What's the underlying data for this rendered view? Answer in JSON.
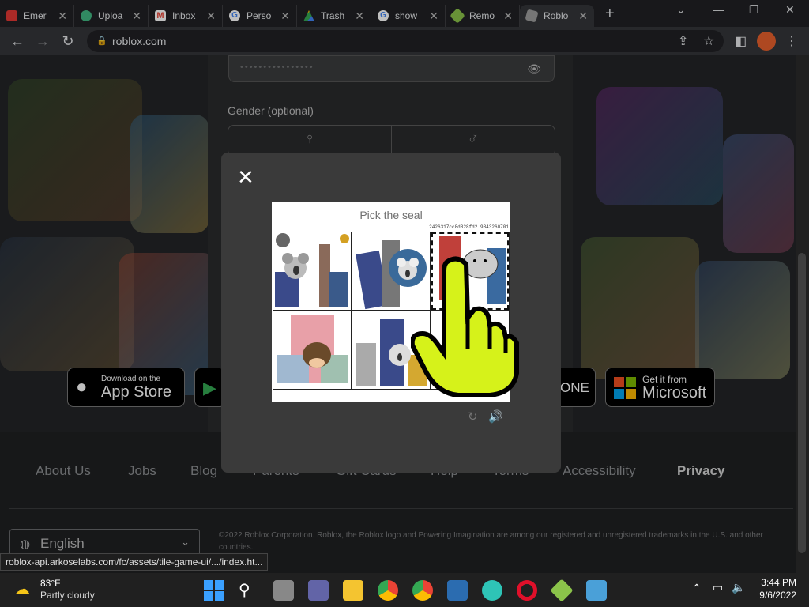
{
  "browser": {
    "tabs": [
      {
        "label": "Emer",
        "color": "#e53935"
      },
      {
        "label": "Uploa",
        "color": "#42b983"
      },
      {
        "label": "Inbox",
        "color": "#ea4335"
      },
      {
        "label": "Perso",
        "color": "#4285f4"
      },
      {
        "label": "Trash",
        "color": "#34a853"
      },
      {
        "label": "show",
        "color": "#4285f4"
      },
      {
        "label": "Remo",
        "color": "#8bc34a"
      },
      {
        "label": "Roblo",
        "color": "#9e9e9e"
      }
    ],
    "url": "roblox.com",
    "new_tab": "+"
  },
  "form": {
    "password_mask": "••••••••••••••••",
    "gender_label": "Gender (optional)"
  },
  "stores": {
    "app_store_top": "Download on the",
    "app_store_bottom": "App Store",
    "xbox_text": "ONE",
    "ms_top": "Get it from",
    "ms_bottom": "Microsoft"
  },
  "footer": {
    "links": [
      "About Us",
      "Jobs",
      "Blog",
      "Parents",
      "Gift Cards",
      "Help",
      "Terms",
      "Accessibility",
      "Privacy"
    ],
    "language": "English",
    "copyright": "©2022 Roblox Corporation. Roblox, the Roblox logo and Powering Imagination are among our registered and unregistered trademarks in the U.S. and other countries."
  },
  "captcha": {
    "prompt": "Pick the seal",
    "session_id": "2426317cc8d828fd2.9843260701",
    "tiles": [
      "koala-city",
      "koala-skyscraper",
      "seal-city",
      "cow-house",
      "koala-buildings",
      "blank"
    ],
    "selected_tile": 3
  },
  "status_url": "roblox-api.arkoselabs.com/fc/assets/tile-game-ui/.../index.ht...",
  "taskbar": {
    "temp": "83°F",
    "weather": "Partly cloudy",
    "time": "3:44 PM",
    "date": "9/6/2022"
  }
}
